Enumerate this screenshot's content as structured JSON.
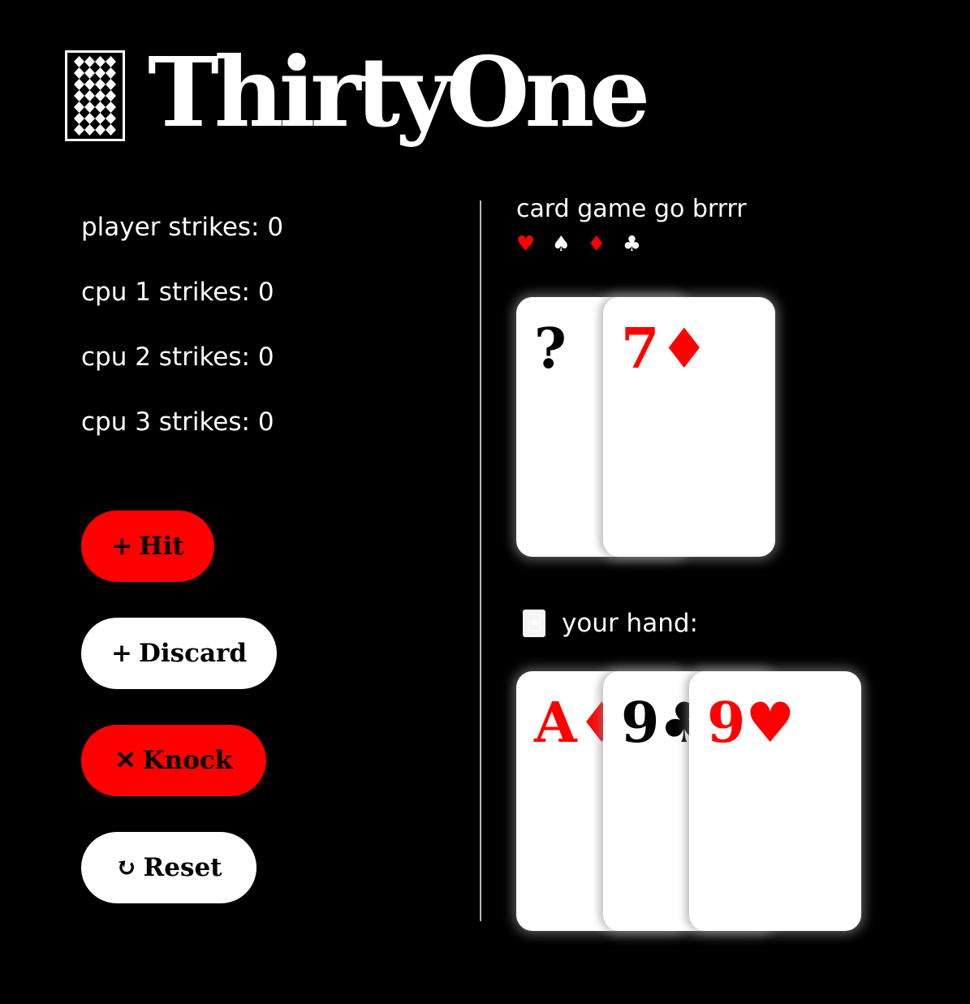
{
  "app": {
    "title": "ThirtyOne",
    "logo_icon": "card-back-icon"
  },
  "strikes": [
    {
      "label": "player strikes: 0"
    },
    {
      "label": "cpu 1 strikes: 0"
    },
    {
      "label": "cpu 2 strikes: 0"
    },
    {
      "label": "cpu 3 strikes: 0"
    }
  ],
  "actions": {
    "hit": {
      "glyph": "+",
      "label": "Hit",
      "color": "#ff0000"
    },
    "discard": {
      "glyph": "+",
      "label": "Discard",
      "color": "#ffffff"
    },
    "knock": {
      "glyph": "✕",
      "label": "Knock",
      "color": "#ff0000"
    },
    "reset": {
      "glyph": "↻",
      "label": "Reset",
      "color": "#ffffff"
    }
  },
  "board": {
    "tagline": "card game go brrrr",
    "suits": [
      "♥",
      "♠",
      "♦",
      "♣"
    ],
    "deck_card": {
      "text": "?"
    },
    "discard_card": {
      "text": "7♦"
    }
  },
  "hand": {
    "label": "your hand:",
    "icon": "joker-card-icon",
    "cards": [
      {
        "text": "A♦"
      },
      {
        "text": "9♣"
      },
      {
        "text": "9♥"
      }
    ]
  },
  "colors": {
    "background": "#000000",
    "accent_red": "#ff0000",
    "card": "#ffffff"
  }
}
